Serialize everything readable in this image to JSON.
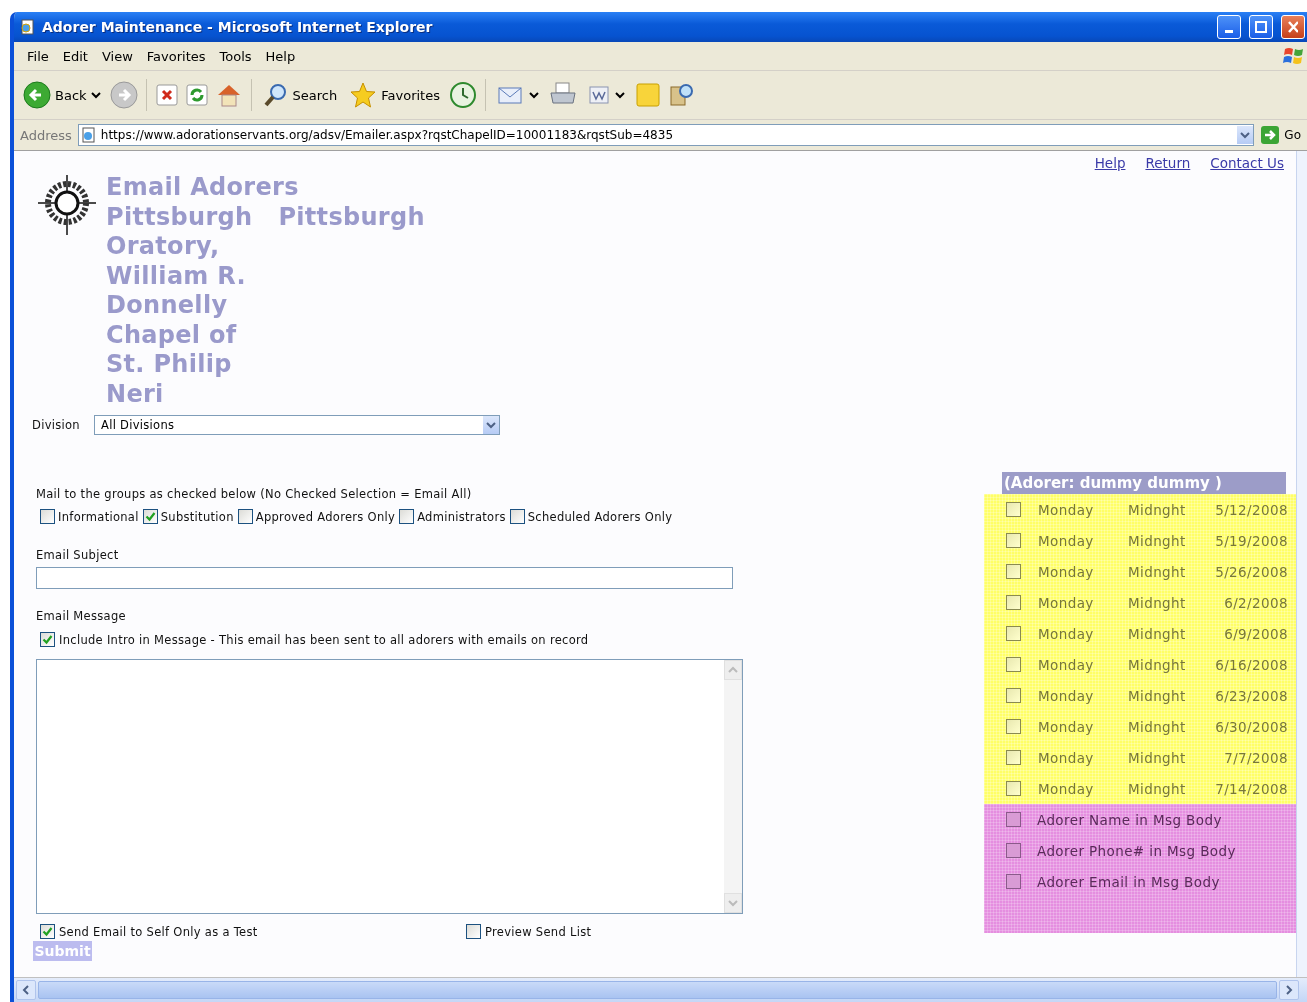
{
  "window": {
    "title": "Adorer Maintenance - Microsoft Internet Explorer"
  },
  "menu": [
    "File",
    "Edit",
    "View",
    "Favorites",
    "Tools",
    "Help"
  ],
  "toolbar": {
    "back": "Back",
    "search": "Search",
    "favorites": "Favorites"
  },
  "address": {
    "label": "Address",
    "url": "https://www.adorationservants.org/adsv/Emailer.aspx?rqstChapelID=10001183&rqstSub=4835",
    "go": "Go"
  },
  "top_links": [
    "Help",
    "Return",
    "Contact Us"
  ],
  "heading": {
    "title": "Email Adorers",
    "city": "Pittsburgh",
    "chapel_lines": [
      "Pittsburgh",
      "Oratory,",
      "William R.",
      "Donnelly",
      "Chapel of",
      "St. Philip",
      "Neri"
    ]
  },
  "division": {
    "label": "Division",
    "value": "All Divisions"
  },
  "groups": {
    "label": "Mail to the groups as checked below (No Checked Selection = Email All)",
    "options": [
      {
        "label": "Informational",
        "checked": false
      },
      {
        "label": "Substitution",
        "checked": true
      },
      {
        "label": "Approved Adorers Only",
        "checked": false
      },
      {
        "label": "Administrators",
        "checked": false
      },
      {
        "label": "Scheduled Adorers Only",
        "checked": false
      }
    ]
  },
  "subject": {
    "label": "Email Subject"
  },
  "message": {
    "label": "Email Message",
    "include_intro": {
      "label": "Include Intro in Message - This email has been sent to all adorers with emails on record",
      "checked": true
    }
  },
  "send_test": {
    "label": "Send Email to Self Only as a Test",
    "checked": true
  },
  "preview": {
    "label": "Preview Send List",
    "checked": false
  },
  "submit": "Submit",
  "adorer_panel": {
    "title": "(Adorer: dummy dummy )",
    "slots": [
      {
        "day": "Monday",
        "time": "Midnght",
        "date": "5/12/2008",
        "checked": false
      },
      {
        "day": "Monday",
        "time": "Midnght",
        "date": "5/19/2008",
        "checked": false
      },
      {
        "day": "Monday",
        "time": "Midnght",
        "date": "5/26/2008",
        "checked": false
      },
      {
        "day": "Monday",
        "time": "Midnght",
        "date": "6/2/2008",
        "checked": false
      },
      {
        "day": "Monday",
        "time": "Midnght",
        "date": "6/9/2008",
        "checked": false
      },
      {
        "day": "Monday",
        "time": "Midnght",
        "date": "6/16/2008",
        "checked": false
      },
      {
        "day": "Monday",
        "time": "Midnght",
        "date": "6/23/2008",
        "checked": false
      },
      {
        "day": "Monday",
        "time": "Midnght",
        "date": "6/30/2008",
        "checked": false
      },
      {
        "day": "Monday",
        "time": "Midnght",
        "date": "7/7/2008",
        "checked": false
      },
      {
        "day": "Monday",
        "time": "Midnght",
        "date": "7/14/2008",
        "checked": false
      }
    ],
    "body_options": [
      {
        "label": "Adorer Name in Msg Body",
        "checked": false
      },
      {
        "label": "Adorer Phone# in Msg Body",
        "checked": false
      },
      {
        "label": "Adorer Email in Msg Body",
        "checked": false
      }
    ]
  }
}
